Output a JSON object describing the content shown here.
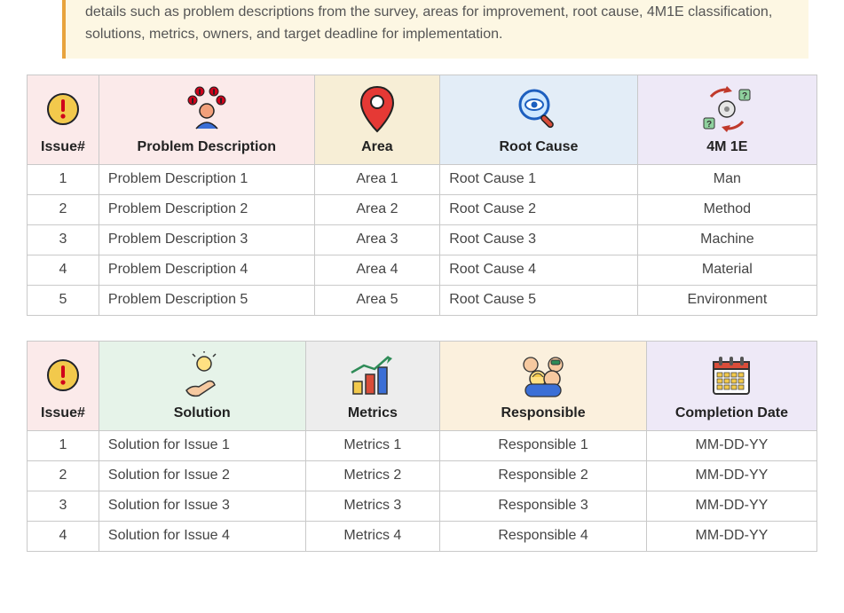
{
  "intro": "details such as problem descriptions from the survey, areas for improvement, root cause, 4M1E classification, solutions, metrics, owners, and target deadline for implementation.",
  "table1": {
    "headers": {
      "issue": "Issue#",
      "problem": "Problem Description",
      "area": "Area",
      "root": "Root Cause",
      "m4e1": "4M 1E"
    },
    "rows": [
      {
        "issue": "1",
        "problem": "Problem Description 1",
        "area": "Area 1",
        "root": "Root Cause 1",
        "m4e1": "Man"
      },
      {
        "issue": "2",
        "problem": "Problem Description 2",
        "area": "Area 2",
        "root": "Root Cause 2",
        "m4e1": "Method"
      },
      {
        "issue": "3",
        "problem": "Problem Description 3",
        "area": "Area 3",
        "root": "Root Cause 3",
        "m4e1": "Machine"
      },
      {
        "issue": "4",
        "problem": "Problem Description 4",
        "area": "Area 4",
        "root": "Root Cause 4",
        "m4e1": "Material"
      },
      {
        "issue": "5",
        "problem": "Problem Description 5",
        "area": "Area 5",
        "root": "Root Cause 5",
        "m4e1": "Environment"
      }
    ]
  },
  "table2": {
    "headers": {
      "issue": "Issue#",
      "solution": "Solution",
      "metrics": "Metrics",
      "responsible": "Responsible",
      "completion": "Completion Date"
    },
    "rows": [
      {
        "issue": "1",
        "solution": "Solution for Issue 1",
        "metrics": "Metrics 1",
        "responsible": "Responsible 1",
        "completion": "MM-DD-YY"
      },
      {
        "issue": "2",
        "solution": "Solution for Issue 2",
        "metrics": "Metrics 2",
        "responsible": "Responsible 2",
        "completion": "MM-DD-YY"
      },
      {
        "issue": "3",
        "solution": "Solution for Issue 3",
        "metrics": "Metrics 3",
        "responsible": "Responsible 3",
        "completion": "MM-DD-YY"
      },
      {
        "issue": "4",
        "solution": "Solution for Issue 4",
        "metrics": "Metrics 4",
        "responsible": "Responsible 4",
        "completion": "MM-DD-YY"
      }
    ]
  }
}
